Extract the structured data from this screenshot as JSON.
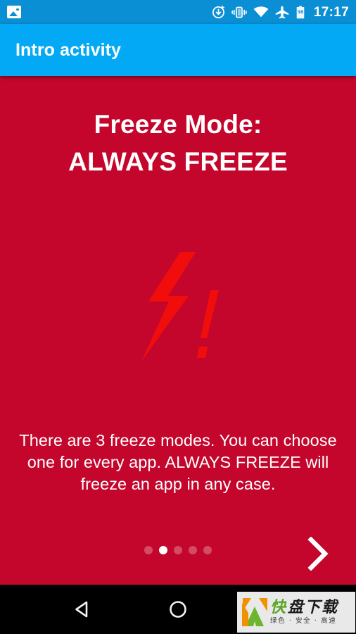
{
  "status_bar": {
    "notification_icon": "image-notification-icon",
    "icons": [
      {
        "name": "sync-download-icon",
        "label": "sync"
      },
      {
        "name": "vibrate-icon",
        "label": "vibrate"
      },
      {
        "name": "wifi-icon",
        "label": "wifi"
      },
      {
        "name": "airplane-mode-icon",
        "label": "airplane mode"
      },
      {
        "name": "battery-icon",
        "label": "38"
      }
    ],
    "battery_level": "38",
    "clock": "17:17",
    "background_color": "#0b8fd4"
  },
  "app_bar": {
    "title": "Intro activity",
    "background_color": "#03a9f4",
    "text_color": "#ffffff"
  },
  "slide": {
    "background_color": "#c4062c",
    "accent_color": "#f20d0d",
    "headline_line1": "Freeze Mode:",
    "headline_line2": "ALWAYS FREEZE",
    "artwork_icon": "lightning-bolt-exclamation-icon",
    "description": "There are 3 freeze modes. You can choose one for every app. ALWAYS FREEZE will freeze an app in any case.",
    "pager": {
      "total": 5,
      "active_index": 1,
      "dots": [
        "1",
        "2",
        "3",
        "4",
        "5"
      ]
    },
    "next_button_icon": "chevron-right-icon"
  },
  "nav_bar": {
    "background_color": "#000000",
    "buttons": [
      {
        "name": "nav-back-button",
        "icon": "back-triangle-icon"
      },
      {
        "name": "nav-home-button",
        "icon": "home-circle-icon"
      }
    ]
  },
  "watermark": {
    "logo_letter": "K",
    "text_green": "快",
    "text_dark": "盘下载",
    "subtitle": "绿色 · 安全 · 高速"
  }
}
